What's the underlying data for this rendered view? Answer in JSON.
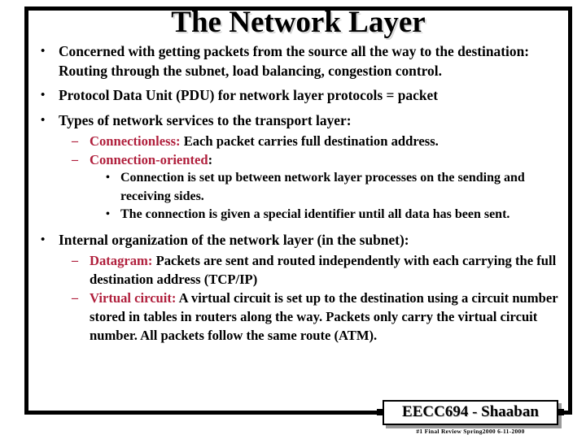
{
  "slide": {
    "title": "The Network Layer",
    "accent_red": "#b01f3c",
    "text_color": "#000000",
    "background": "#ffffff",
    "bullet_glyphs": {
      "level1": "•",
      "level2": "–",
      "level3": "•"
    },
    "content": [
      {
        "level": 1,
        "text": "Concerned with getting packets from the source all the way to the destination:  Routing through the subnet,  load balancing,  congestion control."
      },
      {
        "level": 1,
        "text": "Protocol Data Unit (PDU) for network layer protocols  =  packet"
      },
      {
        "level": 1,
        "text": "Types of network services to the transport layer:"
      },
      {
        "level": 2,
        "red_text": "Connectionless:",
        "text": "  Each packet carries full destination address."
      },
      {
        "level": 2,
        "red_text": "Connection-oriented",
        "text": ":"
      },
      {
        "level": 3,
        "text": "Connection is set up between network layer processes on the sending and receiving sides."
      },
      {
        "level": 3,
        "text": "The connection is given a special identifier until all data has been sent."
      },
      {
        "level": 1,
        "text": "Internal organization of the network layer (in the subnet):"
      },
      {
        "level": 2,
        "red_text": "Datagram:",
        "text": "  Packets are sent and routed independently with each carrying the full destination address  (TCP/IP)"
      },
      {
        "level": 2,
        "red_text": "Virtual circuit:",
        "text": "   A virtual  circuit is set up to the destination using a circuit number stored in tables  in routers along the way.    Packets only carry the virtual circuit number.  All packets follow the same route (ATM)."
      }
    ]
  },
  "footer": {
    "label": "EECC694 - Shaaban",
    "sub": "#1  Final Review   Spring2000   6-11-2000"
  }
}
